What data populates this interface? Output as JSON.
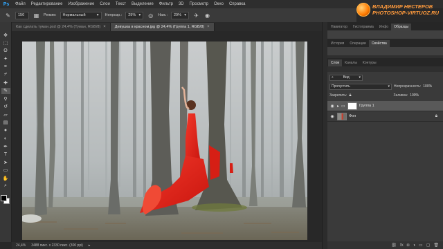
{
  "app": {
    "logo": "Ps"
  },
  "menu": [
    "Файл",
    "Редактирование",
    "Изображение",
    "Слои",
    "Текст",
    "Выделение",
    "Фильтр",
    "3D",
    "Просмотр",
    "Окно",
    "Справка"
  ],
  "window_controls": {
    "minimize": "–",
    "maximize": "□",
    "close": "×"
  },
  "watermark": {
    "name": "ВЛАДИМИР НЕСТЕРОВ",
    "site": "PHOTOSHOP-VIRTUOZ.RU",
    "icon": "globe-logo"
  },
  "options": {
    "brush_size": "150",
    "mode_label": "Режим:",
    "mode_value": "Нормальный",
    "opacity_label": "Непрозр.:",
    "opacity_value": "29%",
    "flow_label": "Наж.:",
    "flow_value": "29%"
  },
  "tools": [
    "move",
    "marquee",
    "lasso",
    "quick-select",
    "crop",
    "eyedropper",
    "healing",
    "brush",
    "clone-stamp",
    "history-brush",
    "eraser",
    "gradient",
    "blur",
    "dodge",
    "pen",
    "type",
    "path-select",
    "shape",
    "hand",
    "zoom"
  ],
  "doc_tabs": [
    {
      "title": "Как сделать туман.psd @ 24,4% (Туман, RGB/8)",
      "close": "×",
      "active": false
    },
    {
      "title": "Девушка в красном.jpg @ 24,4% (Группа 1, RGB/8)",
      "close": "×",
      "active": true
    }
  ],
  "status": {
    "zoom": "24,4%",
    "doc_size": "3488 пикс. x 2330 пикс. (300 ppi)"
  },
  "panel_group_1": {
    "tabs": [
      "Навигатор",
      "Гистограмма",
      "Инфо",
      "Образцы"
    ],
    "active": 3
  },
  "panel_group_2": {
    "tabs": [
      "История",
      "Операции",
      "Свойства"
    ],
    "active": 2
  },
  "layers_tabs": {
    "tabs": [
      "Слои",
      "Каналы",
      "Контуры"
    ],
    "active": 0
  },
  "layers_panel": {
    "filter_label": "Вид",
    "blend_mode": "Пропустить",
    "opacity_label": "Непрозрачность:",
    "opacity_value": "100%",
    "lock_label": "Закрепить:",
    "fill_label": "Заливка:",
    "fill_value": "100%",
    "layers": [
      {
        "name": "Группа 1",
        "type": "group",
        "visible": true,
        "selected": true
      },
      {
        "name": "Фон",
        "type": "background",
        "visible": true,
        "selected": false,
        "locked": true
      }
    ]
  },
  "colors": {
    "accent": "#31a8ff",
    "watermark": "#ff9a3c",
    "dress": "#e8231c"
  }
}
